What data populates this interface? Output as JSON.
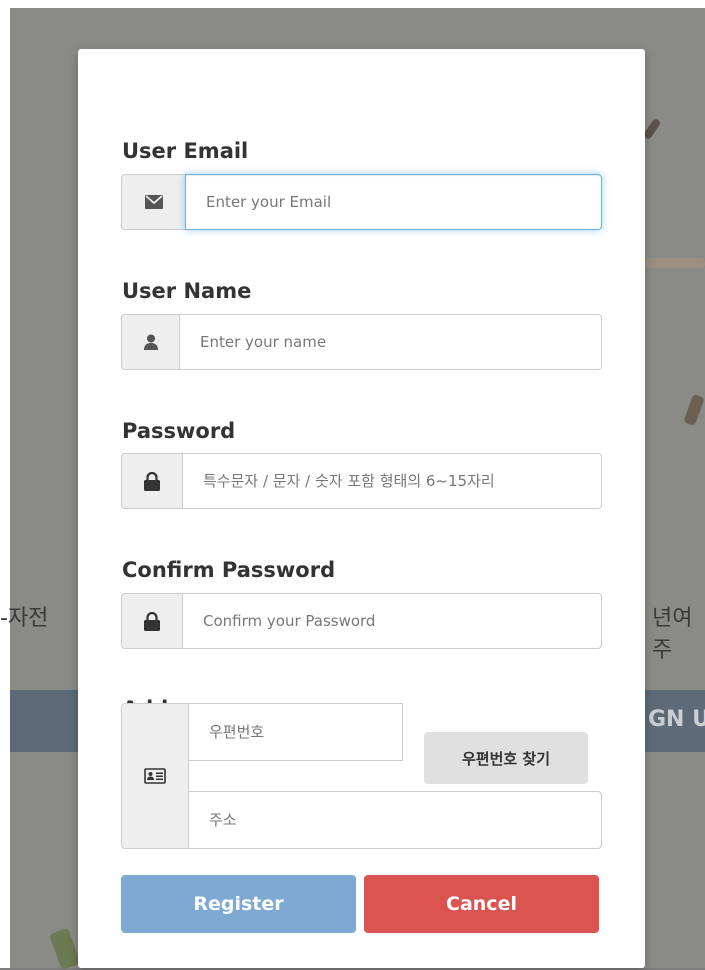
{
  "background": {
    "left_fragment": "-자전",
    "right_fragment": "년여주",
    "band_fragment": "GN U"
  },
  "form": {
    "email": {
      "label": "User Email",
      "placeholder": "Enter your Email",
      "icon": "envelope-icon"
    },
    "name": {
      "label": "User Name",
      "placeholder": "Enter your name",
      "icon": "user-icon"
    },
    "password": {
      "label": "Password",
      "placeholder": "특수문자 / 문자 / 숫자 포함 형태의 6~15자리",
      "icon": "lock-icon"
    },
    "confirm_password": {
      "label": "Confirm Password",
      "placeholder": "Confirm your Password",
      "icon": "lock-icon"
    },
    "address": {
      "label": "Address",
      "zip_placeholder": "우편번호",
      "zip_search_label": "우편번호 찾기",
      "address_placeholder": "주소",
      "icon": "address-card-icon"
    }
  },
  "actions": {
    "register_label": "Register",
    "cancel_label": "Cancel"
  },
  "colors": {
    "register": "#7ea9d3",
    "cancel": "#d9534f",
    "focus_border": "#66afe9",
    "addon_bg": "#eeeeee"
  }
}
